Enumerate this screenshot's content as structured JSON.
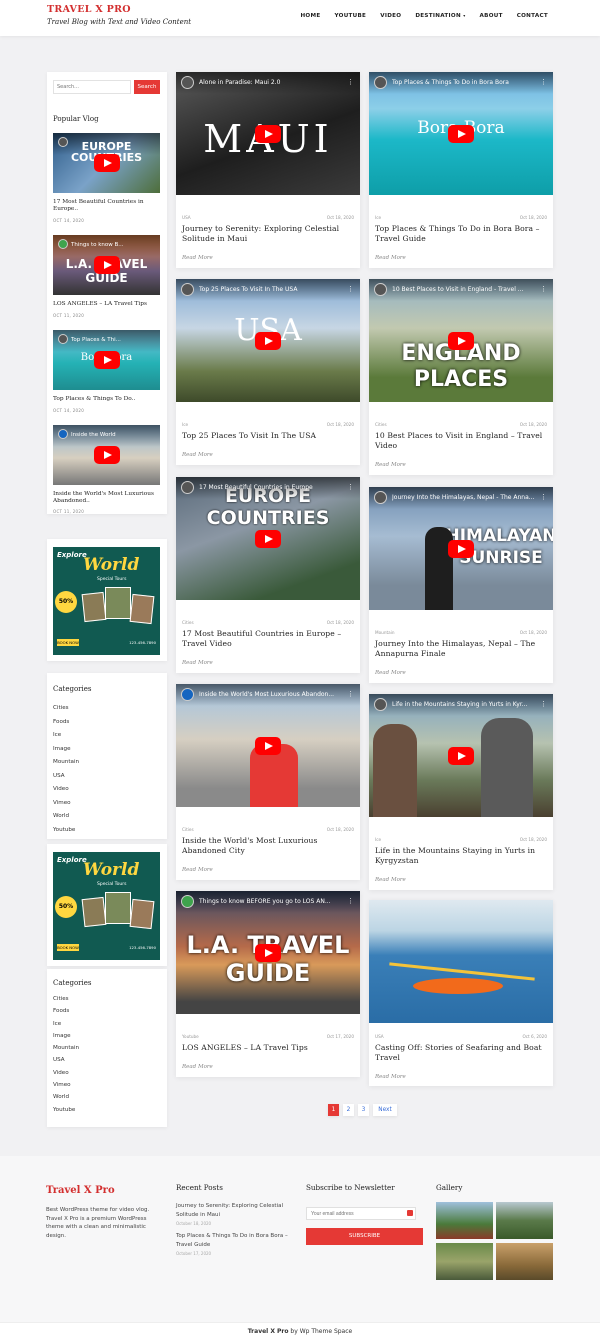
{
  "brand": {
    "title": "TRAVEL X PRO",
    "tagline": "Travel Blog with Text and Video Content"
  },
  "nav": [
    "HOME",
    "YOUTUBE",
    "VIDEO",
    "DESTINATION",
    "ABOUT",
    "CONTACT"
  ],
  "sidebar": {
    "search": {
      "placeholder": "Search...",
      "button": "Search"
    },
    "popular_title": "Popular Vlog",
    "vlogs": [
      {
        "thumb_title": "17 Most Beautiful...",
        "big": "EUROPE COUNTRIES",
        "title": "17 Most Beautiful Countries in Europe..",
        "date": "OCT 14, 2020"
      },
      {
        "thumb_title": "Things to know B...",
        "big": "L.A. TRAVEL GUIDE",
        "title": "LOS ANGELES – LA Travel Tips",
        "date": "OCT 11, 2020"
      },
      {
        "thumb_title": "Top Places & Thi...",
        "big": "Bora Bora",
        "title": "Top Places & Things To Do..",
        "date": "OCT 14, 2020"
      },
      {
        "thumb_title": "Inside the World",
        "big": "",
        "title": "Inside the World's Most Luxurious Abandoned..",
        "date": "OCT 11, 2020"
      }
    ],
    "ad": {
      "explore": "Explore",
      "world": "World",
      "tours": "Special Tours",
      "pct": "50%",
      "book": "BOOK NOW",
      "tel": "123-456-7890"
    },
    "categories_title": "Categories",
    "categories": [
      "Cities",
      "Foods",
      "Ice",
      "Image",
      "Mountain",
      "USA",
      "Video",
      "Vimeo",
      "World",
      "Youtube"
    ]
  },
  "posts": [
    {
      "yt": "Alone in Paradise: Maui 2.0",
      "big": "MAUI",
      "cat": "USA",
      "date": "Oct 18, 2020",
      "title": "Journey to Serenity: Exploring Celestial Solitude in Maui",
      "more": "Read More"
    },
    {
      "yt": "Top Places & Things To Do in Bora Bora",
      "big": "Bora Bora",
      "cat": "Ice",
      "date": "Oct 18, 2020",
      "title": "Top Places & Things To Do in Bora Bora – Travel Guide",
      "more": "Read More"
    },
    {
      "yt": "Top 25 Places To Visit In The USA",
      "big": "USA",
      "cat": "Ice",
      "date": "Oct 18, 2020",
      "title": "Top 25 Places To Visit In The USA",
      "more": "Read More"
    },
    {
      "yt": "10 Best Places to Visit in England - Travel ...",
      "big": "ENGLAND PLACES",
      "cat": "Cities",
      "date": "Oct 18, 2020",
      "title": "10 Best Places to Visit in England – Travel Video",
      "more": "Read More"
    },
    {
      "yt": "17 Most Beautiful Countries in Europe",
      "big": "EUROPE COUNTRIES",
      "cat": "Cities",
      "date": "Oct 18, 2020",
      "title": "17 Most Beautiful Countries in Europe – Travel Video",
      "more": "Read More"
    },
    {
      "yt": "Journey Into the Himalayas, Nepal - The Anna...",
      "big": "HIMALAYAN SUNRISE",
      "cat": "Mountain",
      "date": "Oct 18, 2020",
      "title": "Journey Into the Himalayas, Nepal – The Annapurna Finale",
      "more": "Read More"
    },
    {
      "yt": "Inside the World's Most Luxurious Abandon...",
      "big": "",
      "cat": "Cities",
      "date": "Oct 18, 2020",
      "title": "Inside the World's Most Luxurious Abandoned City",
      "more": "Read More"
    },
    {
      "yt": "Life in the Mountains Staying in Yurts in Kyr...",
      "big": "",
      "cat": "Ice",
      "date": "Oct 18, 2020",
      "title": "Life in the Mountains Staying in Yurts in Kyrgyzstan",
      "more": "Read More"
    },
    {
      "yt": "Things to know BEFORE you go to LOS AN...",
      "big": "L.A. TRAVEL GUIDE",
      "cat": "Youtube",
      "date": "Oct 17, 2020",
      "title": "LOS ANGELES – LA Travel Tips",
      "more": "Read More"
    },
    {
      "yt": "",
      "big": "",
      "cat": "USA",
      "date": "Oct 6, 2020",
      "title": "Casting Off: Stories of Seafaring and Boat Travel",
      "more": "Read More"
    }
  ],
  "pagination": [
    "1",
    "2",
    "3",
    "Next"
  ],
  "footer": {
    "brand": "Travel X Pro",
    "about": "Best WordPress theme for video vlog. Travel X Pro is a premium WordPress theme with a clean and minimalistic design.",
    "recent_title": "Recent Posts",
    "recent": [
      {
        "title": "Journey to Serenity: Exploring Celestial Solitude in Maui",
        "date": "October 18, 2020"
      },
      {
        "title": "Top Places & Things To Do in Bora Bora – Travel Guide",
        "date": "October 17, 2020"
      }
    ],
    "newsletter_title": "Subscribe to Newsletter",
    "newsletter_placeholder": "Your email address",
    "subscribe": "SUBSCRIBE",
    "gallery_title": "Gallery"
  },
  "copyright": {
    "brand": "Travel X Pro",
    "by": " by Wp Theme Space"
  }
}
